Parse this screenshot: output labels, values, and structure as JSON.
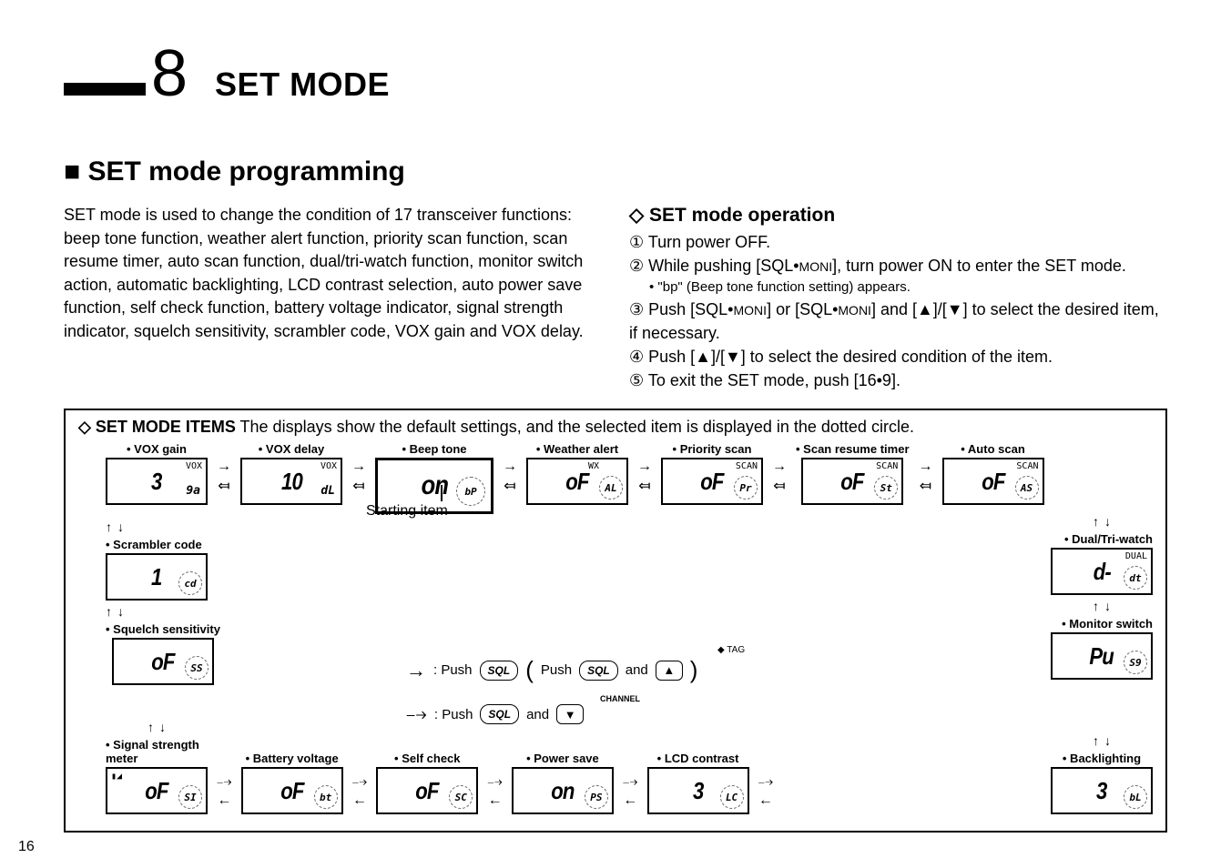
{
  "page_number": "16",
  "chapter_number": "8",
  "chapter_title": "SET MODE",
  "section_title": "■ SET mode programming",
  "intro_text": "SET mode is used to change the condition of 17 transceiver functions: beep tone function, weather alert function, priority scan function, scan resume timer, auto scan function, dual/tri-watch function, monitor switch action, automatic backlighting, LCD contrast selection, auto power save function, self check function, battery voltage indicator, signal strength indicator, squelch sensitivity, scrambler code, VOX gain and VOX delay.",
  "operation_title": "◇ SET mode operation",
  "steps": {
    "s1": "① Turn power OFF.",
    "s2a": "② While pushing [SQL•",
    "s2b": "MONI",
    "s2c": "], turn power ON to enter the SET mode.",
    "s2sub": "• \"bp\" (Beep tone function setting) appears.",
    "s3a": "③ Push [SQL•",
    "s3b": "MONI",
    "s3c": "] or [SQL•",
    "s3d": "MONI",
    "s3e": "] and [▲]/[▼] to select the desired item, if necessary.",
    "s4": "④ Push [▲]/[▼] to select the desired condition of the item.",
    "s5": "⑤ To exit the SET mode, push [16•9]."
  },
  "diagram": {
    "header_label": "◇ SET MODE ITEMS",
    "header_text": "   The displays show the default settings, and the selected item is displayed in the dotted circle.",
    "starting_item": "Starting item",
    "instructions": {
      "push_label": ": Push",
      "and_label": "and",
      "pushb_label": ": Push",
      "push_paren": "Push",
      "sql": "SQL",
      "tag_up": "◆ TAG",
      "channel": "CHANNEL"
    },
    "items": {
      "vox_gain": {
        "label": "• VOX gain",
        "seg": "3",
        "corner": "9a",
        "tiny": "VOX"
      },
      "vox_delay": {
        "label": "• VOX delay",
        "seg": "10",
        "corner": "dL",
        "tiny": "VOX"
      },
      "beep_tone": {
        "label": "• Beep tone",
        "seg": "on",
        "corner": "bP"
      },
      "weather_alert": {
        "label": "• Weather alert",
        "seg": "oF",
        "corner": "AL",
        "tiny": "WX"
      },
      "priority_scan": {
        "label": "• Priority scan",
        "seg": "oF",
        "corner": "Pr",
        "tiny": "SCAN"
      },
      "scan_resume": {
        "label": "• Scan resume timer",
        "seg": "oF",
        "corner": "St",
        "tiny": "SCAN"
      },
      "auto_scan": {
        "label": "• Auto scan",
        "seg": "oF",
        "corner": "AS",
        "tiny": "SCAN"
      },
      "dual_tri_watch": {
        "label": "• Dual/Tri-watch",
        "seg": "d-",
        "corner": "dt",
        "tiny": "DUAL"
      },
      "monitor_switch": {
        "label": "• Monitor switch",
        "seg": "Pu",
        "corner": "S9"
      },
      "backlighting": {
        "label": "• Backlighting",
        "seg": "3",
        "corner": "bL"
      },
      "lcd_contrast": {
        "label": "• LCD contrast",
        "seg": "3",
        "corner": "LC"
      },
      "power_save": {
        "label": "• Power save",
        "seg": "on",
        "corner": "PS"
      },
      "self_check": {
        "label": "• Self check",
        "seg": "oF",
        "corner": "SC"
      },
      "battery_voltage": {
        "label": "• Battery voltage",
        "seg": "oF",
        "corner": "bt"
      },
      "signal_strength": {
        "label": "• Signal strength meter",
        "seg": "oF",
        "corner": "SI"
      },
      "squelch_sens": {
        "label": "• Squelch sensitivity",
        "seg": "oF",
        "corner": "SS"
      },
      "scrambler_code": {
        "label": "• Scrambler code",
        "seg": "1",
        "corner": "cd"
      }
    }
  }
}
